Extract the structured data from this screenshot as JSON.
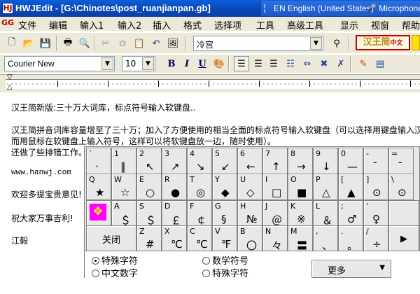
{
  "window": {
    "title": "HWJEdit - [G:\\Chinotes\\post_ruanjianpan.gb]",
    "app_icon": "HJ"
  },
  "language_bar": {
    "language": "EN English (United States)",
    "microphone": "Microphone"
  },
  "menu": {
    "logo": "GG",
    "items": [
      "文件",
      "编辑",
      "输入1",
      "输入2",
      "插入",
      "格式",
      "选择项",
      "工具",
      "高级工具",
      "显示",
      "视窗",
      "帮助"
    ]
  },
  "toolbar": {
    "search_value": "冷宫",
    "brand": "汉王简",
    "brand_small": "中文"
  },
  "format_bar": {
    "font": "Courier New",
    "size": "10",
    "bold": "B",
    "italic": "I",
    "underline": "U"
  },
  "document": {
    "lines": [
      "汉王简新版:三十万大词库，标点符号输入软键盘..",
      "汉王简拼音词库容量增至了三十万；加入了方便使用的相当全面的标点符号输入软键盘（可以选择用键盘输入汉",
      "而用鼠标在软键盘上输入符号，这样可以将软键盘放一边，随时使用）。",
      "还做了些排错工作。",
      "www.hanwj.com",
      "欢迎多提宝贵意见!",
      "祝大家万事吉利!",
      "江毅"
    ]
  },
  "keyboard": {
    "row1": [
      {
        "top": "`",
        "bot": "·"
      },
      {
        "top": "1",
        "bot": "‖"
      },
      {
        "top": "2",
        "bot": "↖"
      },
      {
        "top": "3",
        "bot": "↗"
      },
      {
        "top": "4",
        "bot": "↘"
      },
      {
        "top": "5",
        "bot": "↙"
      },
      {
        "top": "6",
        "bot": "←"
      },
      {
        "top": "7",
        "bot": "↑"
      },
      {
        "top": "8",
        "bot": "→"
      },
      {
        "top": "9",
        "bot": "↓"
      },
      {
        "top": "0",
        "bot": "—"
      },
      {
        "top": "-",
        "bot": "¯"
      },
      {
        "top": "=",
        "bot": "ˉ"
      }
    ],
    "row2": [
      {
        "top": "Q",
        "bot": "★"
      },
      {
        "top": "W",
        "bot": "☆"
      },
      {
        "top": "E",
        "bot": "○"
      },
      {
        "top": "R",
        "bot": "●"
      },
      {
        "top": "T",
        "bot": "◎"
      },
      {
        "top": "Y",
        "bot": "◆"
      },
      {
        "top": "U",
        "bot": "◇"
      },
      {
        "top": "I",
        "bot": "□"
      },
      {
        "top": "O",
        "bot": "■"
      },
      {
        "top": "P",
        "bot": "△"
      },
      {
        "top": "[",
        "bot": "▲"
      },
      {
        "top": "]",
        "bot": "⊙"
      },
      {
        "top": "\\",
        "bot": "⊙"
      }
    ],
    "row3": [
      {
        "top": "A",
        "bot": "＄"
      },
      {
        "top": "S",
        "bot": "＄"
      },
      {
        "top": "D",
        "bot": "￡"
      },
      {
        "top": "F",
        "bot": "￠"
      },
      {
        "top": "G",
        "bot": "§"
      },
      {
        "top": "H",
        "bot": "№"
      },
      {
        "top": "J",
        "bot": "＠"
      },
      {
        "top": "K",
        "bot": "※"
      },
      {
        "top": "L",
        "bot": "＆"
      },
      {
        "top": ";",
        "bot": "♂"
      },
      {
        "top": "'",
        "bot": "♀"
      }
    ],
    "row4": [
      {
        "top": "Z",
        "bot": "#"
      },
      {
        "top": "X",
        "bot": "℃"
      },
      {
        "top": "C",
        "bot": "℃"
      },
      {
        "top": "V",
        "bot": "℉"
      },
      {
        "top": "B",
        "bot": "〇"
      },
      {
        "top": "N",
        "bot": "々"
      },
      {
        "top": "M",
        "bot": "〓"
      },
      {
        "top": ",",
        "bot": "、"
      },
      {
        "top": ".",
        "bot": "。"
      },
      {
        "top": "/",
        "bot": "÷"
      }
    ],
    "close_label": "关闭",
    "enter_label": "▶",
    "options": {
      "special_chars": "特殊字符",
      "chinese_numbers": "中文数字",
      "math_symbols": "数学符号",
      "special_chars2": "特殊字符"
    },
    "more_label": "更多"
  }
}
